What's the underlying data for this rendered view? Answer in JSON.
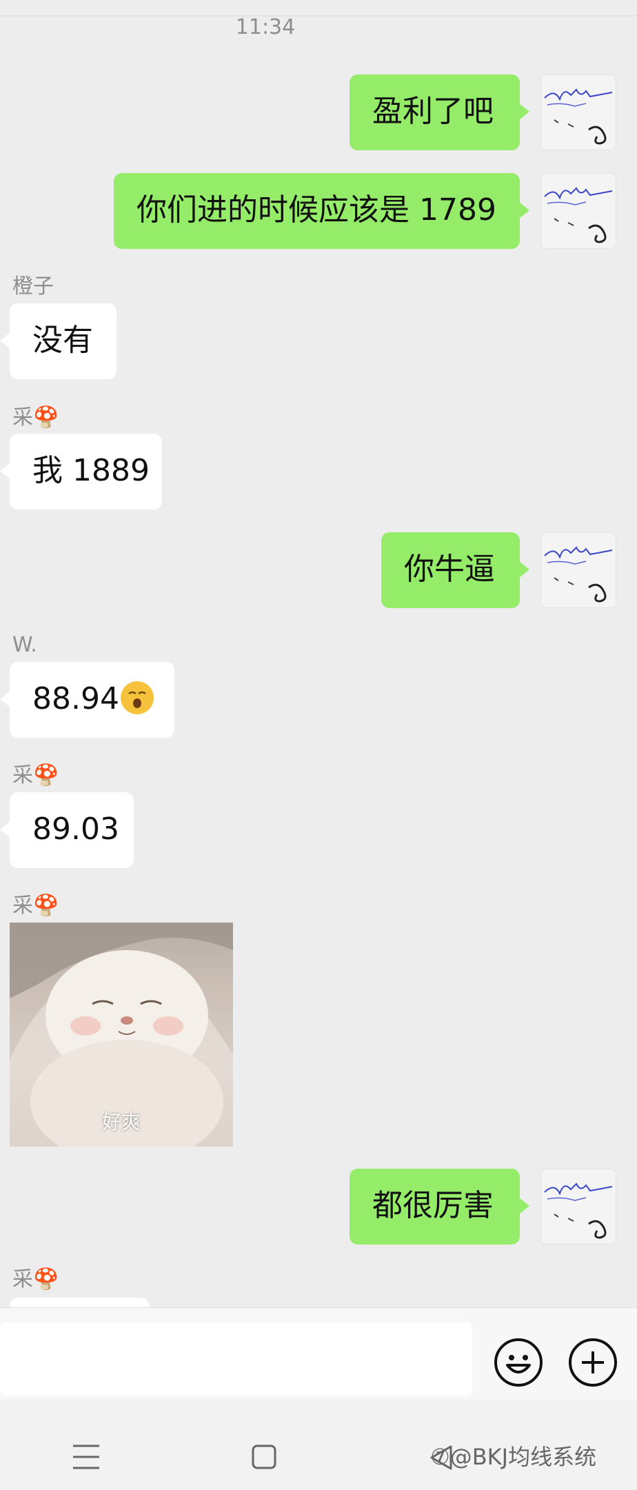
{
  "status": {
    "time": "11:34"
  },
  "messages": {
    "m1": {
      "text": "盈利了吧"
    },
    "m2": {
      "text": "你们进的时候应该是 1789"
    },
    "m3": {
      "sender": "橙子",
      "text": "没有"
    },
    "m4": {
      "sender": "采🍄",
      "text": "我 1889"
    },
    "m5": {
      "text": "你牛逼"
    },
    "m6": {
      "sender": "W.",
      "text": "88.94"
    },
    "m7": {
      "sender": "采🍄",
      "text": "89.03"
    },
    "m8": {
      "sender": "采🍄",
      "sticker_caption": "好爽"
    },
    "m9": {
      "text": "都很厉害"
    },
    "m10": {
      "sender": "采🍄"
    }
  },
  "icons": {
    "emoji_button": "smiley-icon",
    "more_button": "plus-circle-icon",
    "nav_menu": "menu-icon",
    "nav_home": "square-icon",
    "nav_back": "back-triangle-icon"
  },
  "colors": {
    "background": "#ededed",
    "my_bubble": "#95ec69",
    "other_bubble": "#ffffff"
  },
  "watermark": "⑦@BKJ均线系统"
}
